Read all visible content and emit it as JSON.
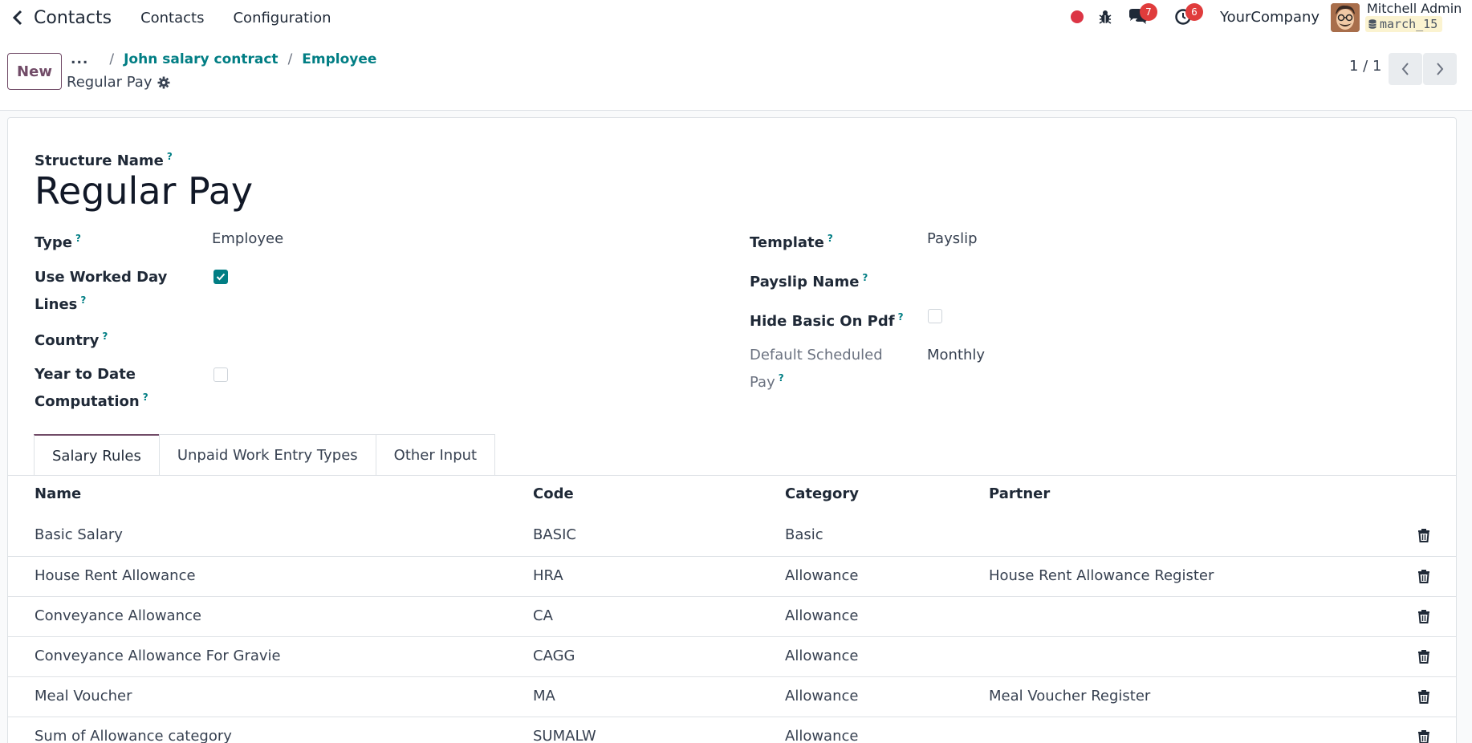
{
  "topbar": {
    "app_name": "Contacts",
    "menu": [
      "Contacts",
      "Configuration"
    ],
    "messages_count": "7",
    "activities_count": "6",
    "company": "YourCompany",
    "user_name": "Mitchell Admin",
    "database": "march_15"
  },
  "control": {
    "new_label": "New",
    "breadcrumb_ellipsis": "...",
    "breadcrumbs": [
      "John salary contract",
      "Employee"
    ],
    "record_title": "Regular Pay",
    "pager": "1 / 1"
  },
  "form": {
    "structure_name_label": "Structure Name",
    "structure_name": "Regular Pay",
    "type_label": "Type",
    "type_value": "Employee",
    "use_worked_day_label_1": "Use Worked Day",
    "use_worked_day_label_2": "Lines",
    "use_worked_day_checked": true,
    "country_label": "Country",
    "ytd_label_1": "Year to Date",
    "ytd_label_2": "Computation",
    "ytd_checked": false,
    "template_label": "Template",
    "template_value": "Payslip",
    "payslip_name_label": "Payslip Name",
    "hide_basic_label": "Hide Basic On Pdf",
    "hide_basic_checked": false,
    "default_pay_label_1": "Default Scheduled",
    "default_pay_label_2": "Pay",
    "default_pay_value": "Monthly",
    "help_mark": "?"
  },
  "tabs": [
    "Salary Rules",
    "Unpaid Work Entry Types",
    "Other Input"
  ],
  "table": {
    "columns": [
      "Name",
      "Code",
      "Category",
      "Partner"
    ],
    "rows": [
      {
        "name": "Basic Salary",
        "code": "BASIC",
        "category": "Basic",
        "partner": ""
      },
      {
        "name": "House Rent Allowance",
        "code": "HRA",
        "category": "Allowance",
        "partner": "House Rent Allowance Register"
      },
      {
        "name": "Conveyance Allowance",
        "code": "CA",
        "category": "Allowance",
        "partner": ""
      },
      {
        "name": "Conveyance Allowance For Gravie",
        "code": "CAGG",
        "category": "Allowance",
        "partner": ""
      },
      {
        "name": "Meal Voucher",
        "code": "MA",
        "category": "Allowance",
        "partner": "Meal Voucher Register"
      },
      {
        "name": "Sum of Allowance category",
        "code": "SUMALW",
        "category": "Allowance",
        "partner": ""
      }
    ]
  },
  "colors": {
    "brand": "#714b67",
    "link": "#017e84",
    "badge": "#e03c3c",
    "record": "#dc3545"
  }
}
